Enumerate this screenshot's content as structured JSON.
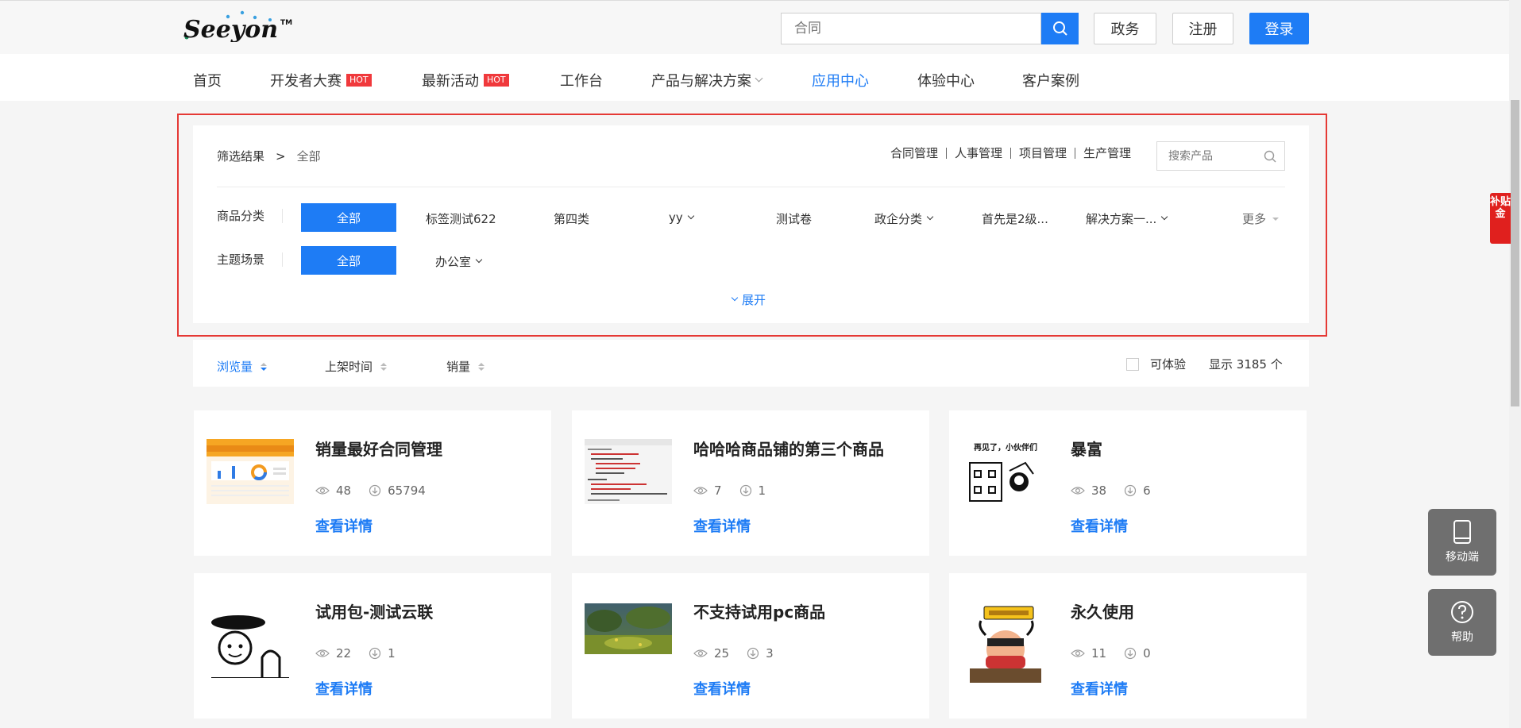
{
  "header": {
    "logo_text": "Seeyon",
    "search_placeholder": "合同",
    "gov_label": "政务",
    "register_label": "注册",
    "login_label": "登录"
  },
  "nav": {
    "items": [
      {
        "label": "首页"
      },
      {
        "label": "开发者大赛",
        "badge": "HOT"
      },
      {
        "label": "最新活动",
        "badge": "HOT"
      },
      {
        "label": "工作台"
      },
      {
        "label": "产品与解决方案"
      },
      {
        "label": "应用中心"
      },
      {
        "label": "体验中心"
      },
      {
        "label": "客户案例"
      }
    ]
  },
  "filter": {
    "crumb_label": "筛选结果",
    "crumb_sep": ">",
    "crumb_current": "全部",
    "quick_links": [
      "合同管理",
      "人事管理",
      "项目管理",
      "生产管理"
    ],
    "search_placeholder": "搜索产品",
    "category_label": "商品分类",
    "category_all": "全部",
    "categories": [
      "标签测试622",
      "第四类",
      "yy",
      "测试卷",
      "政企分类",
      "首先是2级...",
      "解决方案一..."
    ],
    "more_label": "更多",
    "theme_label": "主题场景",
    "theme_all": "全部",
    "themes": [
      "办公室"
    ],
    "expand_label": "展开"
  },
  "sortbar": {
    "sort_views": "浏览量",
    "sort_time": "上架时间",
    "sort_sales": "销量",
    "trial_label": "可体验",
    "count_prefix": "显示",
    "count_value": "3185",
    "count_suffix": "个"
  },
  "products": [
    {
      "title": "销量最好合同管理",
      "views": "48",
      "downloads": "65794",
      "detail": "查看详情"
    },
    {
      "title": "哈哈哈商品铺的第三个商品",
      "views": "7",
      "downloads": "1",
      "detail": "查看详情"
    },
    {
      "title": "暴富",
      "views": "38",
      "downloads": "6",
      "detail": "查看详情"
    },
    {
      "title": "试用包-测试云联",
      "views": "22",
      "downloads": "1",
      "detail": "查看详情"
    },
    {
      "title": "不支持试用pc商品",
      "views": "25",
      "downloads": "3",
      "detail": "查看详情"
    },
    {
      "title": "永久使用",
      "views": "11",
      "downloads": "0",
      "detail": "查看详情"
    }
  ],
  "thumb_text": {
    "meme_caption": "再见了，小伙伴们"
  },
  "widgets": {
    "subsidy": "补贴金",
    "mobile_label": "移动端",
    "help_label": "帮助"
  },
  "colors": {
    "accent": "#1e7cf5",
    "hot": "#f0393c",
    "highlight_border": "#e53935"
  }
}
